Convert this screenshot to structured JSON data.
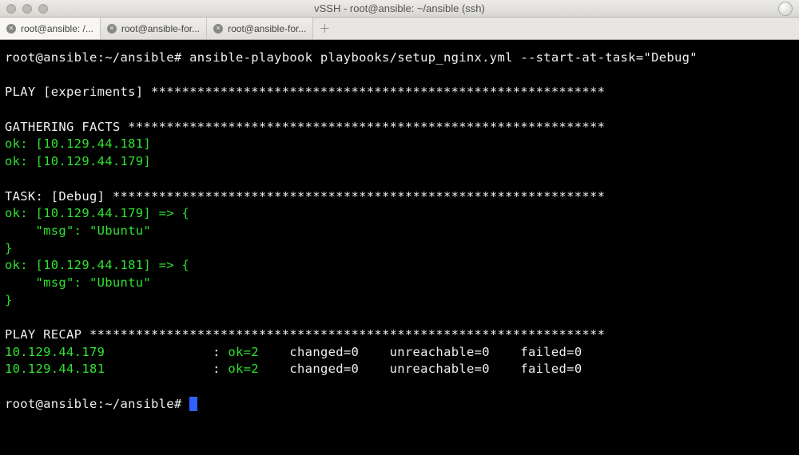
{
  "window": {
    "title": "vSSH - root@ansible: ~/ansible (ssh)"
  },
  "tabs": [
    {
      "label": "root@ansible: /..."
    },
    {
      "label": "root@ansible-for..."
    },
    {
      "label": "root@ansible-for..."
    }
  ],
  "terminal": {
    "prompt": "root@ansible:~/ansible#",
    "command": "ansible-playbook playbooks/setup_nginx.yml --start-at-task=\"Debug\"",
    "play_header": "PLAY [experiments]",
    "play_stars": "***********************************************************",
    "facts_header": "GATHERING FACTS",
    "facts_stars": "**************************************************************",
    "facts_ok1": "ok: [10.129.44.181]",
    "facts_ok2": "ok: [10.129.44.179]",
    "task_header": "TASK: [Debug]",
    "task_stars": "****************************************************************",
    "task_ok1_head": "ok: [10.129.44.179] => {",
    "task_msg_line": "    \"msg\": \"Ubuntu\"",
    "task_ok1_close": "}",
    "task_ok2_head": "ok: [10.129.44.181] => {",
    "task_ok2_close": "}",
    "recap_header": "PLAY RECAP",
    "recap_stars": "*******************************************************************",
    "recap_host1": "10.129.44.179",
    "recap_host2": "10.129.44.181",
    "recap_colon": ":",
    "recap_ok": "ok=2",
    "recap_changed": "changed=0",
    "recap_unreach": "unreachable=0",
    "recap_failed": "failed=0"
  }
}
